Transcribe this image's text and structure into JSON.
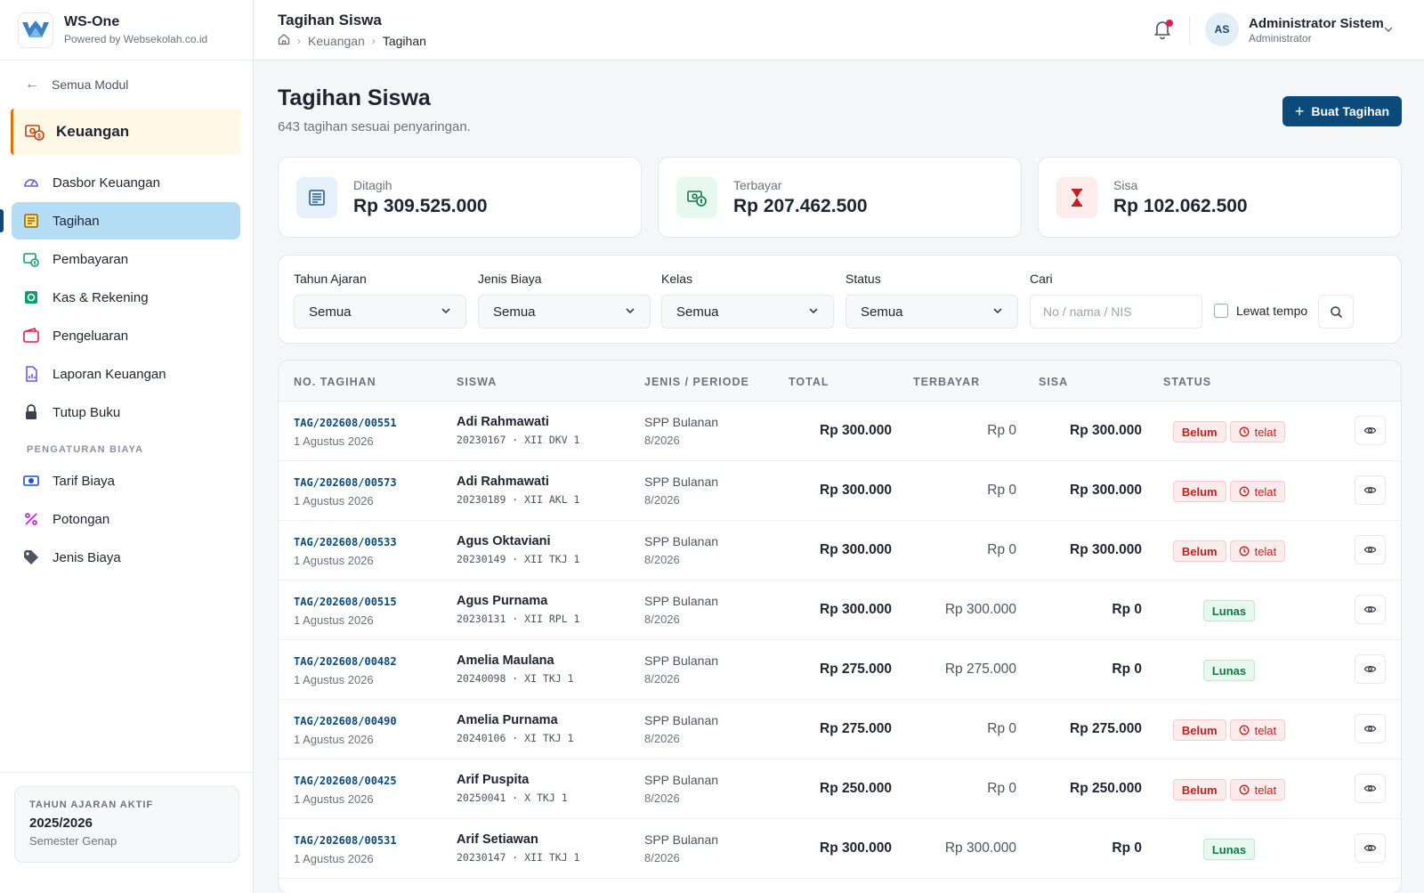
{
  "brand": {
    "name": "WS-One",
    "sub": "Powered by Websekolah.co.id"
  },
  "sidebar": {
    "back_label": "Semua Modul",
    "module_label": "Keuangan",
    "items": [
      {
        "label": "Dasbor Keuangan",
        "icon": "gauge-icon"
      },
      {
        "label": "Tagihan",
        "icon": "invoice-icon",
        "active": true
      },
      {
        "label": "Pembayaran",
        "icon": "payment-icon"
      },
      {
        "label": "Kas & Rekening",
        "icon": "cash-icon"
      },
      {
        "label": "Pengeluaran",
        "icon": "wallet-icon"
      },
      {
        "label": "Laporan Keuangan",
        "icon": "report-icon"
      },
      {
        "label": "Tutup Buku",
        "icon": "lock-icon"
      }
    ],
    "section_label": "PENGATURAN BIAYA",
    "settings_items": [
      {
        "label": "Tarif Biaya",
        "icon": "tariff-icon"
      },
      {
        "label": "Potongan",
        "icon": "percent-icon"
      },
      {
        "label": "Jenis Biaya",
        "icon": "tag-icon"
      }
    ],
    "year_card": {
      "label": "TAHUN AJARAN AKTIF",
      "value": "2025/2026",
      "semester": "Semester Genap"
    }
  },
  "topbar": {
    "title": "Tagihan Siswa",
    "breadcrumb": [
      "Keuangan",
      "Tagihan"
    ],
    "user": {
      "initials": "AS",
      "name": "Administrator Sistem",
      "role": "Administrator"
    }
  },
  "page": {
    "title": "Tagihan Siswa",
    "subtitle": "643 tagihan sesuai penyaringan.",
    "create_button": "Buat Tagihan"
  },
  "stats": [
    {
      "label": "Ditagih",
      "value": "Rp 309.525.000",
      "color": "#1d5c91"
    },
    {
      "label": "Terbayar",
      "value": "Rp 207.462.500",
      "color": "#0f7a45"
    },
    {
      "label": "Sisa",
      "value": "Rp 102.062.500",
      "color": "#c81e1e"
    }
  ],
  "filters": {
    "tahun_ajaran": {
      "label": "Tahun Ajaran",
      "value": "Semua"
    },
    "jenis_biaya": {
      "label": "Jenis Biaya",
      "value": "Semua"
    },
    "kelas": {
      "label": "Kelas",
      "value": "Semua"
    },
    "status": {
      "label": "Status",
      "value": "Semua"
    },
    "cari": {
      "label": "Cari",
      "placeholder": "No / nama / NIS"
    },
    "lewat_tempo": "Lewat tempo"
  },
  "table": {
    "headers": [
      "NO. TAGIHAN",
      "SISWA",
      "JENIS / PERIODE",
      "TOTAL",
      "TERBAYAR",
      "SISA",
      "STATUS"
    ],
    "rows": [
      {
        "no": "TAG/202608/00551",
        "date": "1 Agustus 2026",
        "name": "Adi Rahmawati",
        "nis": "20230167 · XII DKV 1",
        "jenis": "SPP Bulanan",
        "periode": "8/2026",
        "total": "Rp 300.000",
        "paid": "Rp 0",
        "sisa": "Rp 300.000",
        "status": "Belum",
        "late": "telat"
      },
      {
        "no": "TAG/202608/00573",
        "date": "1 Agustus 2026",
        "name": "Adi Rahmawati",
        "nis": "20230189 · XII AKL 1",
        "jenis": "SPP Bulanan",
        "periode": "8/2026",
        "total": "Rp 300.000",
        "paid": "Rp 0",
        "sisa": "Rp 300.000",
        "status": "Belum",
        "late": "telat"
      },
      {
        "no": "TAG/202608/00533",
        "date": "1 Agustus 2026",
        "name": "Agus Oktaviani",
        "nis": "20230149 · XII TKJ 1",
        "jenis": "SPP Bulanan",
        "periode": "8/2026",
        "total": "Rp 300.000",
        "paid": "Rp 0",
        "sisa": "Rp 300.000",
        "status": "Belum",
        "late": "telat"
      },
      {
        "no": "TAG/202608/00515",
        "date": "1 Agustus 2026",
        "name": "Agus Purnama",
        "nis": "20230131 · XII RPL 1",
        "jenis": "SPP Bulanan",
        "periode": "8/2026",
        "total": "Rp 300.000",
        "paid": "Rp 300.000",
        "sisa": "Rp 0",
        "status": "Lunas",
        "late": ""
      },
      {
        "no": "TAG/202608/00482",
        "date": "1 Agustus 2026",
        "name": "Amelia Maulana",
        "nis": "20240098 · XI TKJ 1",
        "jenis": "SPP Bulanan",
        "periode": "8/2026",
        "total": "Rp 275.000",
        "paid": "Rp 275.000",
        "sisa": "Rp 0",
        "status": "Lunas",
        "late": ""
      },
      {
        "no": "TAG/202608/00490",
        "date": "1 Agustus 2026",
        "name": "Amelia Purnama",
        "nis": "20240106 · XI TKJ 1",
        "jenis": "SPP Bulanan",
        "periode": "8/2026",
        "total": "Rp 275.000",
        "paid": "Rp 0",
        "sisa": "Rp 275.000",
        "status": "Belum",
        "late": "telat"
      },
      {
        "no": "TAG/202608/00425",
        "date": "1 Agustus 2026",
        "name": "Arif Puspita",
        "nis": "20250041 · X TKJ 1",
        "jenis": "SPP Bulanan",
        "periode": "8/2026",
        "total": "Rp 250.000",
        "paid": "Rp 0",
        "sisa": "Rp 250.000",
        "status": "Belum",
        "late": "telat"
      },
      {
        "no": "TAG/202608/00531",
        "date": "1 Agustus 2026",
        "name": "Arif Setiawan",
        "nis": "20230147 · XII TKJ 1",
        "jenis": "SPP Bulanan",
        "periode": "8/2026",
        "total": "Rp 300.000",
        "paid": "Rp 300.000",
        "sisa": "Rp 0",
        "status": "Lunas",
        "late": ""
      }
    ]
  }
}
